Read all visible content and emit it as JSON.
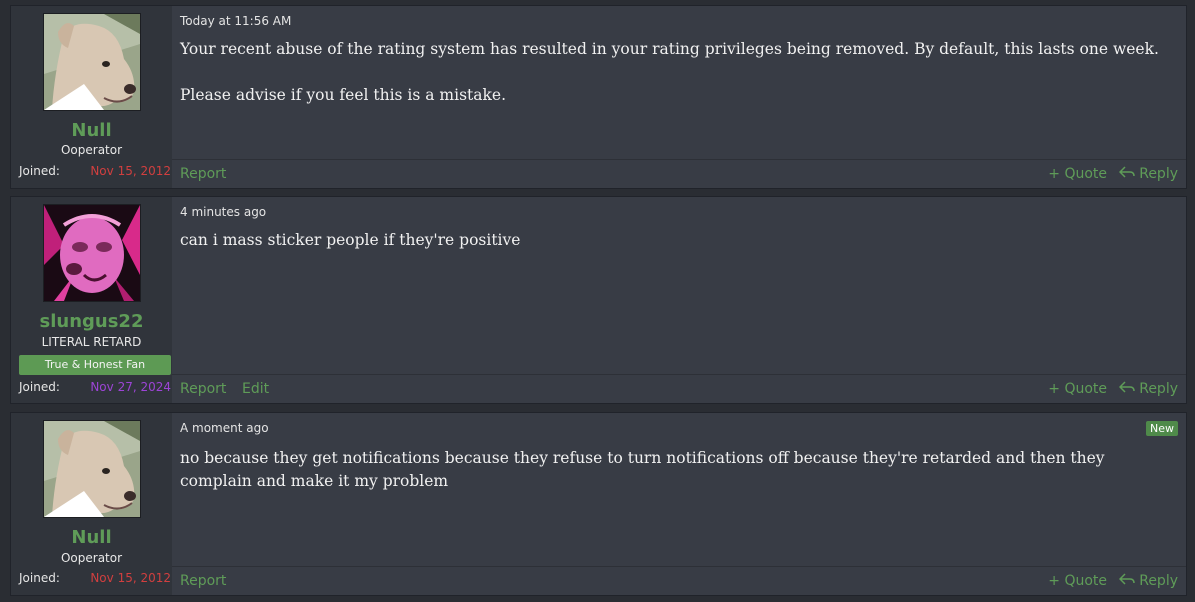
{
  "posts": [
    {
      "username": "Null",
      "user_title": "Ooperator",
      "joined_label": "Joined:",
      "joined_date": "Nov 15, 2012",
      "timestamp": "Today at 11:56 AM",
      "message": [
        "Your recent abuse of the rating system has resulted in your rating privileges being removed. By default, this lasts one week.",
        "Please advise if you feel this is a mistake."
      ],
      "actions": {
        "report": "Report",
        "quote": "Quote",
        "reply": "Reply"
      }
    },
    {
      "username": "slungus22",
      "user_title": "LITERAL RETARD",
      "banner": "True & Honest Fan",
      "joined_label": "Joined:",
      "joined_date": "Nov 27, 2024",
      "timestamp": "4 minutes ago",
      "message": [
        "can i mass sticker people if they're positive"
      ],
      "actions": {
        "report": "Report",
        "edit": "Edit",
        "quote": "Quote",
        "reply": "Reply"
      }
    },
    {
      "username": "Null",
      "user_title": "Ooperator",
      "joined_label": "Joined:",
      "joined_date": "Nov 15, 2012",
      "timestamp": "A moment ago",
      "badge": "New",
      "message": [
        "no because they get notifications because they refuse to turn notifications off because they're retarded and then they complain and make it my problem"
      ],
      "actions": {
        "report": "Report",
        "quote": "Quote",
        "reply": "Reply"
      }
    }
  ],
  "icons": {
    "quote": "plus-icon",
    "reply": "reply-arrow-icon"
  },
  "colors": {
    "accent": "#5f9c58",
    "joined_date_null": "#d13f3f",
    "joined_date_slungus": "#9c44d6",
    "banner_bg": "#5d9a54",
    "post_bg": "#383c45",
    "user_cell_bg": "#30343b"
  }
}
